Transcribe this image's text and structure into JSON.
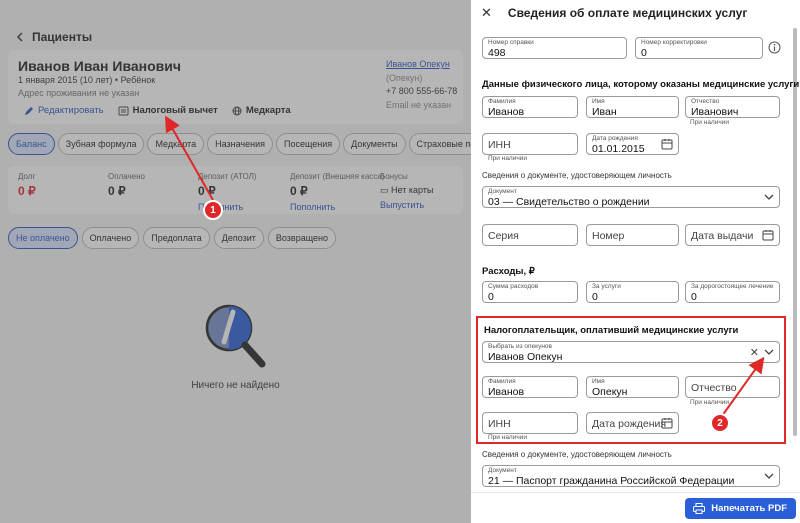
{
  "background": {
    "back_label": "Пациенты",
    "patient": {
      "name": "Иванов Иван Иванович",
      "subline": "1 января 2015 (10 лет) • Ребёнок",
      "address": "Адрес проживания не указан",
      "guardian_link": "Иванов Опекун",
      "guardian_role": "(Опекун)",
      "guardian_phone": "+7 800 555-66-78",
      "guardian_email": "Email не указан"
    },
    "actions": {
      "edit": "Редактировать",
      "tax": "Налоговый вычет",
      "medcard": "Медкарта"
    },
    "tabs": [
      "Баланс",
      "Зубная формула",
      "Медкарта",
      "Назначения",
      "Посещения",
      "Документы",
      "Страховые полисы"
    ],
    "balance": {
      "debt_label": "Долг",
      "debt_value": "0 ₽",
      "paid_label": "Оплачено",
      "paid_value": "0 ₽",
      "deposit_atol_label": "Депозит (АТОЛ)",
      "deposit_atol_value": "0 ₽",
      "deposit_atol_link": "Пополнить",
      "deposit_ext_label": "Депозит (Внешняя касса)",
      "deposit_ext_value": "0 ₽",
      "deposit_ext_link": "Пополнить",
      "bonus_label": "Бонусы",
      "bonus_value": "Нет карты",
      "bonus_link": "Выпустить"
    },
    "filters": [
      "Не оплачено",
      "Оплачено",
      "Предоплата",
      "Депозит",
      "Возвращено"
    ],
    "empty_text": "Ничего не найдено"
  },
  "drawer": {
    "title": "Сведения об оплате медицинских услуг",
    "cert_number_label": "Номер справки",
    "cert_number_value": "498",
    "correction_label": "Номер корректировки",
    "correction_value": "0",
    "person_section": "Данные физического лица, которому оказаны медицинские услуги",
    "surname_label": "Фамилия",
    "surname_value": "Иванов",
    "name_label": "Имя",
    "name_value": "Иван",
    "patronymic_label": "Отчество",
    "patronymic_value": "Иванович",
    "if_any": "При наличии",
    "inn_placeholder": "ИНН",
    "birth_label": "Дата рождения",
    "birth_value": "01.01.2015",
    "doc_sub": "Сведения о документе, удостоверяющем личность",
    "doc_label": "Документ",
    "doc_value": "03 — Свидетельство о рождении",
    "series_placeholder": "Серия",
    "number_placeholder": "Номер",
    "issue_placeholder": "Дата выдачи",
    "expenses_section": "Расходы, ₽",
    "sum_label": "Сумма расходов",
    "sum_value": "0",
    "services_label": "За услуги",
    "services_value": "0",
    "expensive_label": "За дорогостоящее лечение",
    "expensive_value": "0",
    "payer_section": "Налогоплательщик, оплативший медицинские услуги",
    "guardian_select_label": "Выбрать из опекунов",
    "guardian_select_value": "Иванов Опекун",
    "payer_surname_value": "Иванов",
    "payer_name_value": "Опекун",
    "patronymic_placeholder": "Отчество",
    "birth_placeholder": "Дата рождения",
    "doc2_value": "21 — Паспорт гражданина Российской Федерации",
    "print_button": "Напечатать PDF"
  },
  "markers": {
    "m1": "1",
    "m2": "2"
  },
  "colors": {
    "accent": "#2a5fd8",
    "highlight": "#e02828"
  }
}
